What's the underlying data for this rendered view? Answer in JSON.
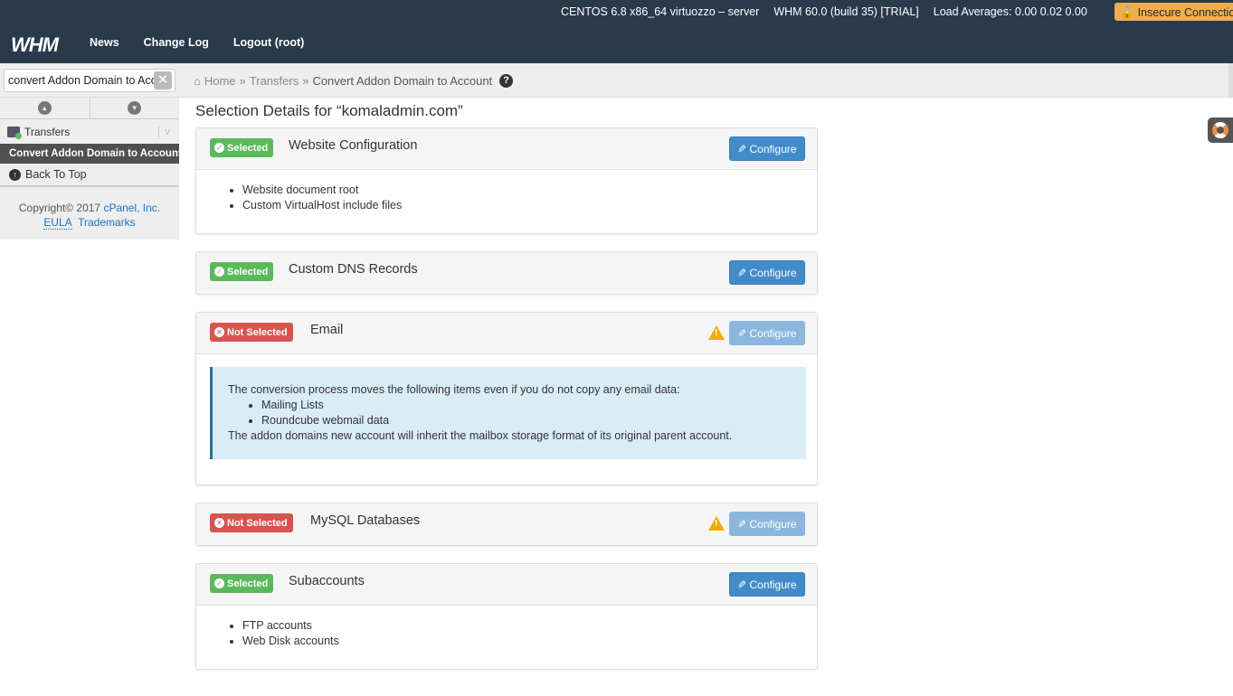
{
  "header": {
    "logo": "WHM",
    "nav": [
      "News",
      "Change Log",
      "Logout (root)"
    ],
    "server_info": "CENTOS 6.8 x86_64 virtuozzo – server",
    "version": "WHM 60.0 (build 35) [TRIAL]",
    "load_averages": "Load Averages: 0.00 0.02 0.00",
    "insecure_label": "Insecure Connection"
  },
  "search": {
    "value": "convert Addon Domain to Account",
    "clear_symbol": "✕"
  },
  "breadcrumb": {
    "home": "Home",
    "sep": "»",
    "section": "Transfers",
    "current": "Convert Addon Domain to Account",
    "help_symbol": "?"
  },
  "sidebar": {
    "category": "Transfers",
    "toggle_symbol": "v",
    "active_item": "Convert Addon Domain to Account",
    "back_to_top": "Back To Top",
    "copyright_text": "Copyright© 2017",
    "copyright_link": "cPanel, Inc.",
    "eula": "EULA",
    "trademarks": "Trademarks"
  },
  "main": {
    "title": "Selection Details for “komaladmin.com”",
    "configure_label": "Configure",
    "panels": [
      {
        "status": "Selected",
        "title": "Website Configuration",
        "items": [
          "Website document root",
          "Custom VirtualHost include files"
        ]
      },
      {
        "status": "Selected",
        "title": "Custom DNS Records"
      },
      {
        "status": "Not Selected",
        "title": "Email",
        "warning": true,
        "alert": {
          "intro": "The conversion process moves the following items even if you do not copy any email data:",
          "items": [
            "Mailing Lists",
            "Roundcube webmail data"
          ],
          "outro": "The addon domains new account will inherit the mailbox storage format of its original parent account."
        }
      },
      {
        "status": "Not Selected",
        "title": "MySQL Databases",
        "warning": true
      },
      {
        "status": "Selected",
        "title": "Subaccounts",
        "items": [
          "FTP accounts",
          "Web Disk accounts"
        ]
      }
    ]
  },
  "colors": {
    "header_bg": "#293a4a",
    "selected": "#5cb85c",
    "not_selected": "#d9534f",
    "primary": "#428bca",
    "warning": "#f0ad4e",
    "info_bg": "#d9edf7"
  }
}
